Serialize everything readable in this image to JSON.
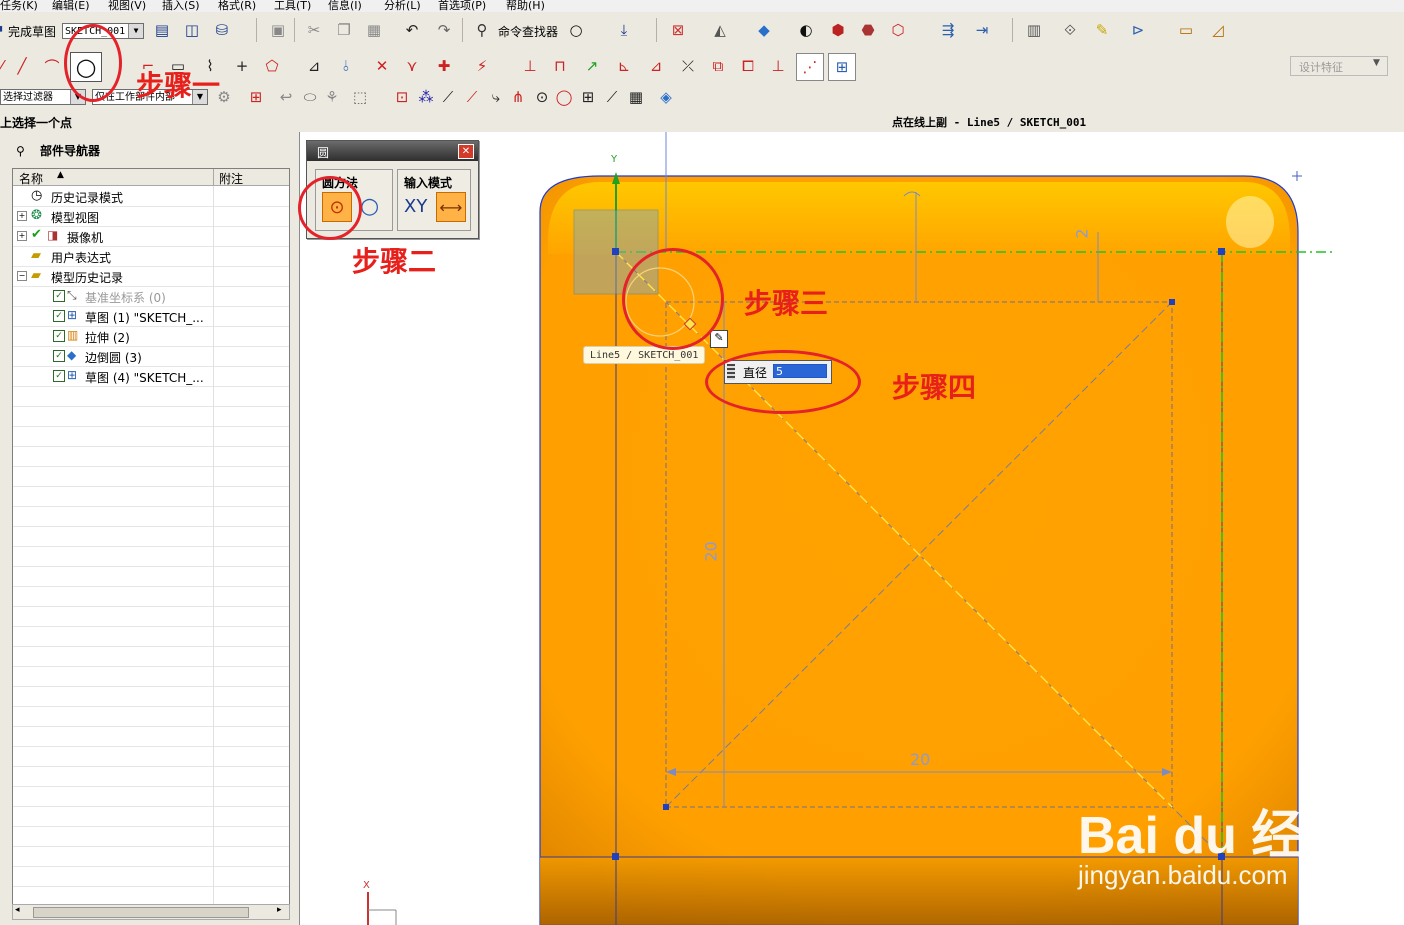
{
  "menu": [
    "任务(K)",
    "编辑(E)",
    "视图(V)",
    "插入(S)",
    "格式(R)",
    "工具(T)",
    "信息(I)",
    "分析(L)",
    "首选项(P)",
    "帮助(H)"
  ],
  "toolbar": {
    "finish_sketch": "完成草图",
    "sketch_name": "SKETCH_001",
    "command_finder": "命令查找器",
    "design_feature": "设计特征",
    "select_filter": "选择过滤器",
    "scope_filter": "仅在工作部件内部"
  },
  "status": {
    "prompt": "上选择一个点",
    "info": "点在线上副 - Line5 / SKETCH_001"
  },
  "navigator": {
    "title": "部件导航器",
    "col_name": "名称",
    "col_note": "附注",
    "items": [
      {
        "label": "历史记录模式"
      },
      {
        "label": "模型视图"
      },
      {
        "label": "摄像机"
      },
      {
        "label": "用户表达式"
      },
      {
        "label": "模型历史记录"
      },
      {
        "label": "基准坐标系 (0)"
      },
      {
        "label": "草图 (1) \"SKETCH_..."
      },
      {
        "label": "拉伸 (2)"
      },
      {
        "label": "边倒圆 (3)"
      },
      {
        "label": "草图 (4) \"SKETCH_..."
      }
    ]
  },
  "dialog": {
    "title": "圆",
    "method_label": "圆方法",
    "input_label": "输入模式",
    "xy_label": "XY"
  },
  "annotations": {
    "step1": "步骤一",
    "step2": "步骤二",
    "step3": "步骤三",
    "step4": "步骤四"
  },
  "graphics": {
    "tooltip": "Line5 / SKETCH_001",
    "diameter_label": "直径",
    "diameter_value": "5",
    "dim_top": "2",
    "dim_left": "20",
    "dim_bottom": "20",
    "axis_y": "Y",
    "axis_x": "X"
  },
  "colors": {
    "body_orange": "#ffa500",
    "body_highlight": "#ffd11a",
    "annotation_red": "#e8201b",
    "sketch_green": "#22c422"
  },
  "watermark": {
    "brand": "Bai du 经验",
    "url": "jingyan.baidu.com"
  }
}
